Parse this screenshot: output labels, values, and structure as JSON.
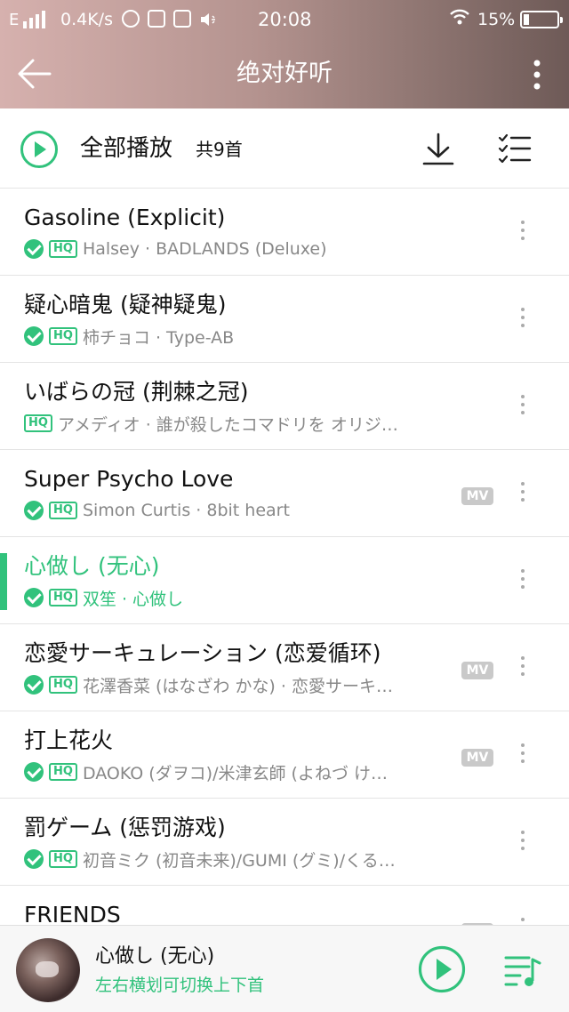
{
  "status_bar": {
    "network": "E",
    "speed": "0.4K/s",
    "time": "20:08",
    "battery": "15%"
  },
  "header": {
    "title": "绝对好听",
    "back_icon": "arrow-left-icon",
    "more_icon": "more-vertical-icon"
  },
  "toolbar": {
    "play_all_label": "全部播放",
    "count": "共9首",
    "download_icon": "download-icon",
    "list_icon": "multi-select-list-icon"
  },
  "songs": [
    {
      "title": "Gasoline (Explicit)",
      "downloaded": true,
      "hq": true,
      "mv": false,
      "artist": "Halsey · BADLANDS (Deluxe)"
    },
    {
      "title": "疑心暗鬼 (疑神疑鬼)",
      "downloaded": true,
      "hq": true,
      "mv": false,
      "artist": "柿チョコ · Type-AB"
    },
    {
      "title": "いばらの冠 (荆棘之冠)",
      "downloaded": false,
      "hq": true,
      "mv": false,
      "artist": "アメディオ · 誰が殺したコマドリを オリジ…"
    },
    {
      "title": "Super Psycho Love",
      "downloaded": true,
      "hq": true,
      "mv": true,
      "artist": "Simon Curtis · 8bit heart"
    },
    {
      "title": "心做し (无心)",
      "downloaded": true,
      "hq": true,
      "mv": false,
      "artist": "双笙 · 心做し",
      "playing": true
    },
    {
      "title": "恋愛サーキュレーション (恋爱循环)",
      "downloaded": true,
      "hq": true,
      "mv": true,
      "artist": "花澤香菜 (はなざわ かな) · 恋愛サーキ…"
    },
    {
      "title": "打上花火",
      "downloaded": true,
      "hq": true,
      "mv": true,
      "artist": "DAOKO (ダヲコ)/米津玄師 (よねづ け…"
    },
    {
      "title": "罰ゲーム (惩罚游戏)",
      "downloaded": true,
      "hq": true,
      "mv": false,
      "artist": "初音ミク (初音未来)/GUMI (グミ)/くる…"
    },
    {
      "title": "FRIENDS",
      "downloaded": false,
      "hq": false,
      "mv": true,
      "artist": ""
    }
  ],
  "labels": {
    "hq": "HQ",
    "mv": "MV"
  },
  "player": {
    "title": "心做し (无心)",
    "hint": "左右横划可切换上下首",
    "play_icon": "play-circle-icon",
    "queue_icon": "playlist-queue-icon"
  },
  "colors": {
    "accent": "#31c27c",
    "header_start": "#d6b1ae",
    "header_end": "#6e5a57"
  }
}
